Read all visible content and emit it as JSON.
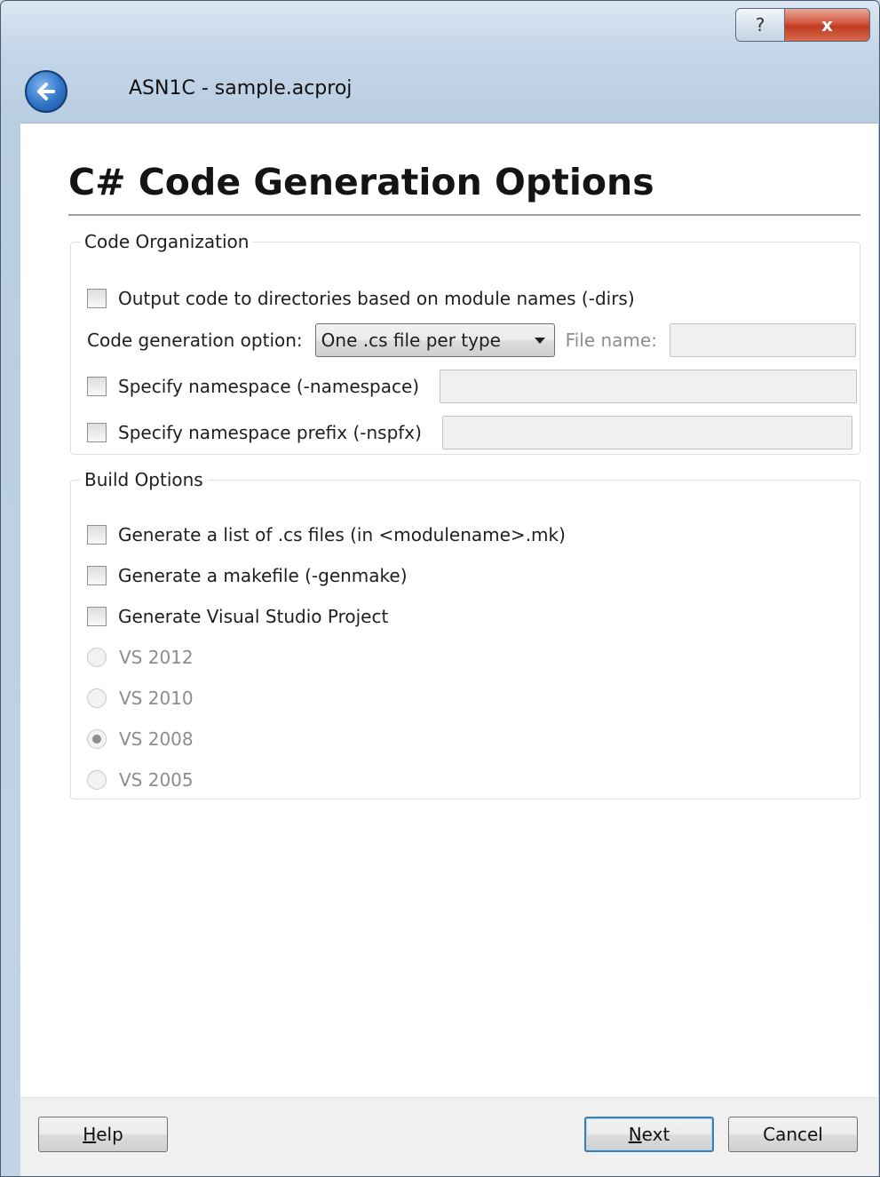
{
  "window": {
    "title": "ASN1C - sample.acproj",
    "help_glyph": "?",
    "close_glyph": "x",
    "back_icon": "back-arrow-icon"
  },
  "page": {
    "title": "C# Code Generation Options"
  },
  "code_organization": {
    "legend": "Code Organization",
    "dirs_label": "Output code to directories based on module names (-dirs)",
    "dirs_checked": false,
    "codegen_label": "Code generation option:",
    "codegen_value": "One .cs file per type",
    "filename_label": "File name:",
    "filename_value": "",
    "namespace_label": "Specify namespace (-namespace)",
    "namespace_checked": false,
    "namespace_value": "",
    "nspfx_label": "Specify namespace prefix (-nspfx)",
    "nspfx_checked": false,
    "nspfx_value": ""
  },
  "build_options": {
    "legend": "Build Options",
    "checkboxes": [
      {
        "label": "Generate a list of .cs files (in <modulename>.mk)",
        "checked": false
      },
      {
        "label": "Generate a makefile (-genmake)",
        "checked": false
      },
      {
        "label": "Generate Visual Studio Project",
        "checked": false
      }
    ],
    "vs_versions": [
      {
        "label": "VS 2012",
        "selected": false,
        "enabled": false
      },
      {
        "label": "VS 2010",
        "selected": false,
        "enabled": false
      },
      {
        "label": "VS 2008",
        "selected": true,
        "enabled": false
      },
      {
        "label": "VS 2005",
        "selected": false,
        "enabled": false
      }
    ]
  },
  "footer": {
    "help_mnemonic": "H",
    "help_rest": "elp",
    "next_mnemonic": "N",
    "next_rest": "ext",
    "cancel": "Cancel"
  }
}
